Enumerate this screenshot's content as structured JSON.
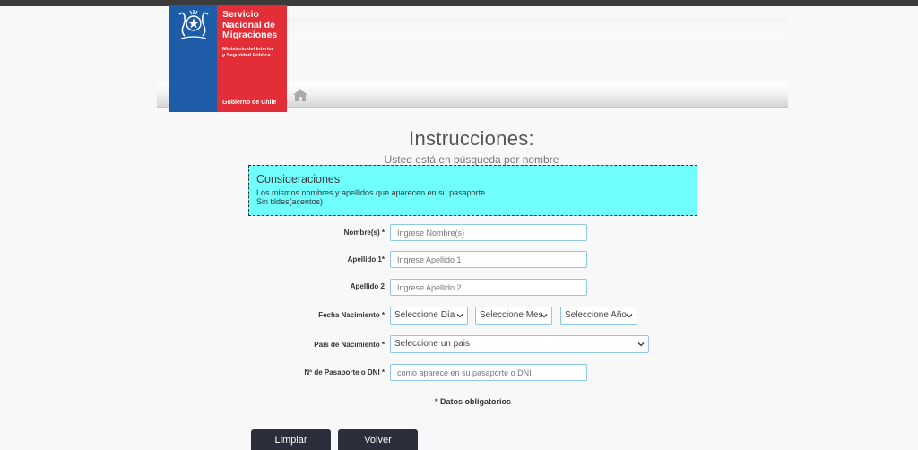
{
  "logo": {
    "title_line1": "Servicio",
    "title_line2": "Nacional de",
    "title_line3": "Migraciones",
    "subtitle_line1": "Ministerio del Interior",
    "subtitle_line2": "y Seguridad Pública",
    "government": "Gobierno de Chile"
  },
  "page": {
    "title": "Instrucciones:",
    "subtitle": "Usted está en búsqueda por nombre"
  },
  "notice": {
    "heading": "Consideraciones",
    "line1": "Los mismos nombres y apellidos que aparecen en su pasaporte",
    "line2": "Sin tildes(acentos)"
  },
  "form": {
    "nombre_label": "Nombre(s) *",
    "nombre_placeholder": "Ingrese Nombre(s)",
    "apellido1_label": "Apellido 1*",
    "apellido1_placeholder": "Ingrese Apellido 1",
    "apellido2_label": "Apellido 2",
    "apellido2_placeholder": "Ingrese Apellido 2",
    "fecha_label": "Fecha Nacimiento *",
    "dia_value": "Seleccione Día",
    "mes_value": "Seleccione Mes",
    "anio_value": "Seleccione Año",
    "pais_label": "País de Nacimiento *",
    "pais_value": "Seleccione un pais",
    "pasaporte_label": "Nº de Pasaporte o DNI *",
    "pasaporte_placeholder": "como aparece en su pasaporte o DNI",
    "required_note": "* Datos obligatorios"
  },
  "buttons": {
    "clear": "Limpiar",
    "back": "Volver"
  },
  "colors": {
    "logo_blue": "#1f5ca8",
    "logo_red": "#e42e37",
    "notice_bg": "#70ffff",
    "button_bg": "#2c2e3b",
    "input_border": "#8fc8e6"
  },
  "icons": {
    "home": "home-icon",
    "crest": "chile-crest-icon",
    "dropdown": "chevron-down-icon"
  }
}
